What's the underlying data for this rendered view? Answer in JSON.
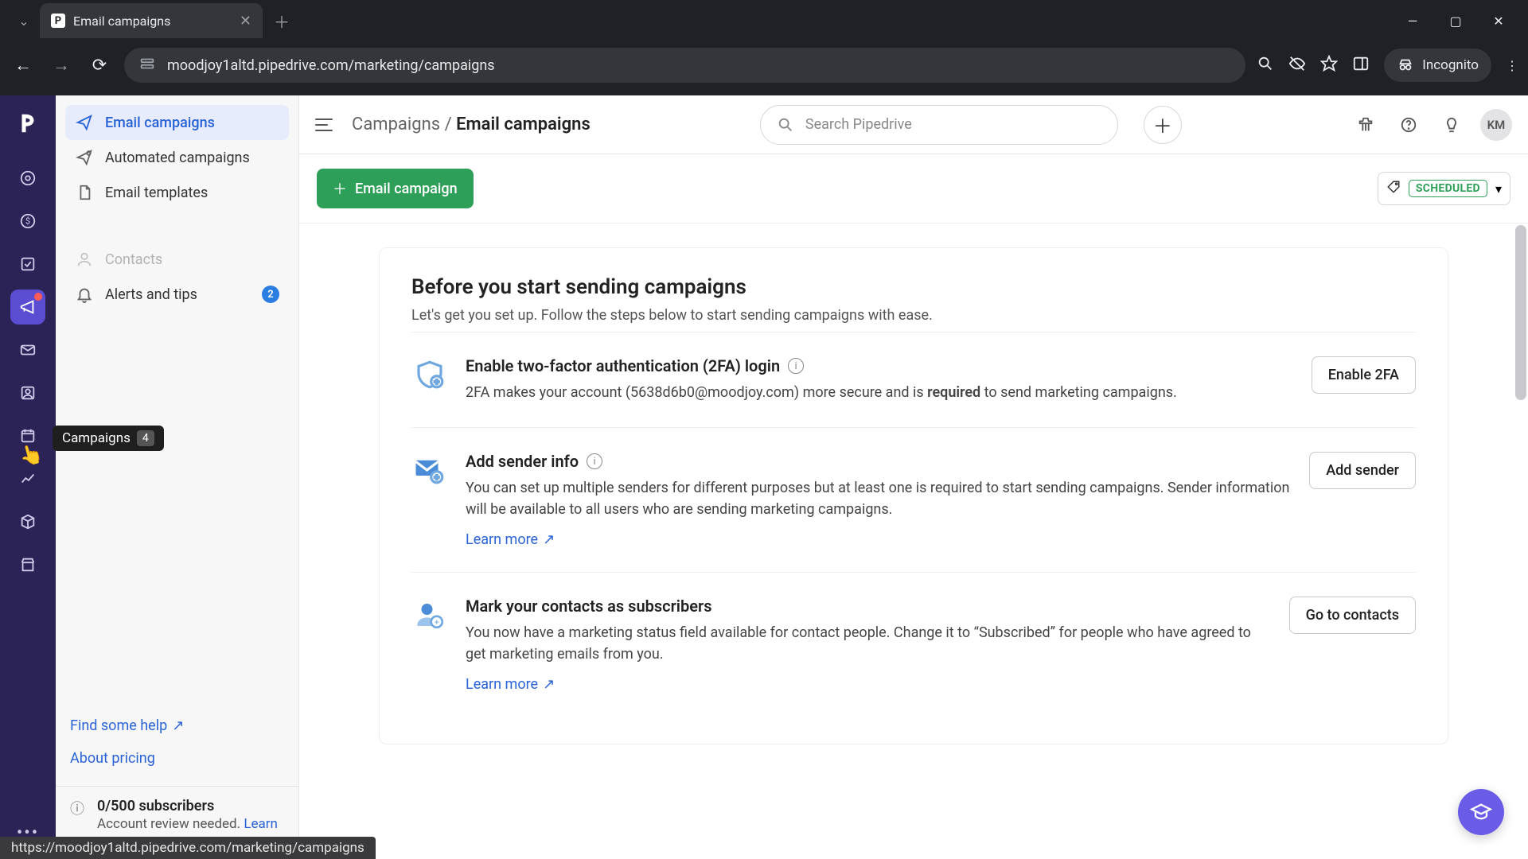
{
  "browser": {
    "tab_title": "Email campaigns",
    "url": "moodjoy1altd.pipedrive.com/marketing/campaigns",
    "incognito_label": "Incognito",
    "status_url": "https://moodjoy1altd.pipedrive.com/marketing/campaigns"
  },
  "rail": {
    "tooltip_label": "Campaigns",
    "tooltip_badge": "4"
  },
  "sidebar": {
    "items": [
      {
        "label": "Email campaigns"
      },
      {
        "label": "Automated campaigns"
      },
      {
        "label": "Email templates"
      },
      {
        "label": "Contacts"
      },
      {
        "label": "Alerts and tips",
        "badge": "2"
      }
    ],
    "help_link": "Find some help",
    "pricing_link": "About pricing",
    "subs_title": "0/500 subscribers",
    "subs_body": "Account review needed.",
    "subs_learn": "Learn more"
  },
  "topbar": {
    "crumb_root": "Campaigns",
    "crumb_sep": " / ",
    "crumb_leaf": "Email campaigns",
    "search_placeholder": "Search Pipedrive",
    "avatar": "KM"
  },
  "actionbar": {
    "primary": "Email campaign",
    "filter_label": "SCHEDULED"
  },
  "onboard": {
    "heading": "Before you start sending campaigns",
    "sub": "Let's get you set up. Follow the steps below to start sending campaigns with ease.",
    "steps": [
      {
        "title": "Enable two-factor authentication (2FA) login",
        "body_pre": "2FA makes your account (5638d6b0@moodjoy.com) more secure and is ",
        "body_bold": "required",
        "body_post": " to send marketing campaigns.",
        "action": "Enable 2FA",
        "learn": ""
      },
      {
        "title": "Add sender info",
        "body_pre": "You can set up multiple senders for different purposes but at least one is required to start sending campaigns. Sender information will be available to all users who are sending marketing campaigns.",
        "body_bold": "",
        "body_post": "",
        "action": "Add sender",
        "learn": "Learn more"
      },
      {
        "title": "Mark your contacts as subscribers",
        "body_pre": "You now have a marketing status field available for contact people. Change it to “Subscribed” for people who have agreed to get marketing emails from you.",
        "body_bold": "",
        "body_post": "",
        "action": "Go to contacts",
        "learn": "Learn more"
      }
    ]
  }
}
